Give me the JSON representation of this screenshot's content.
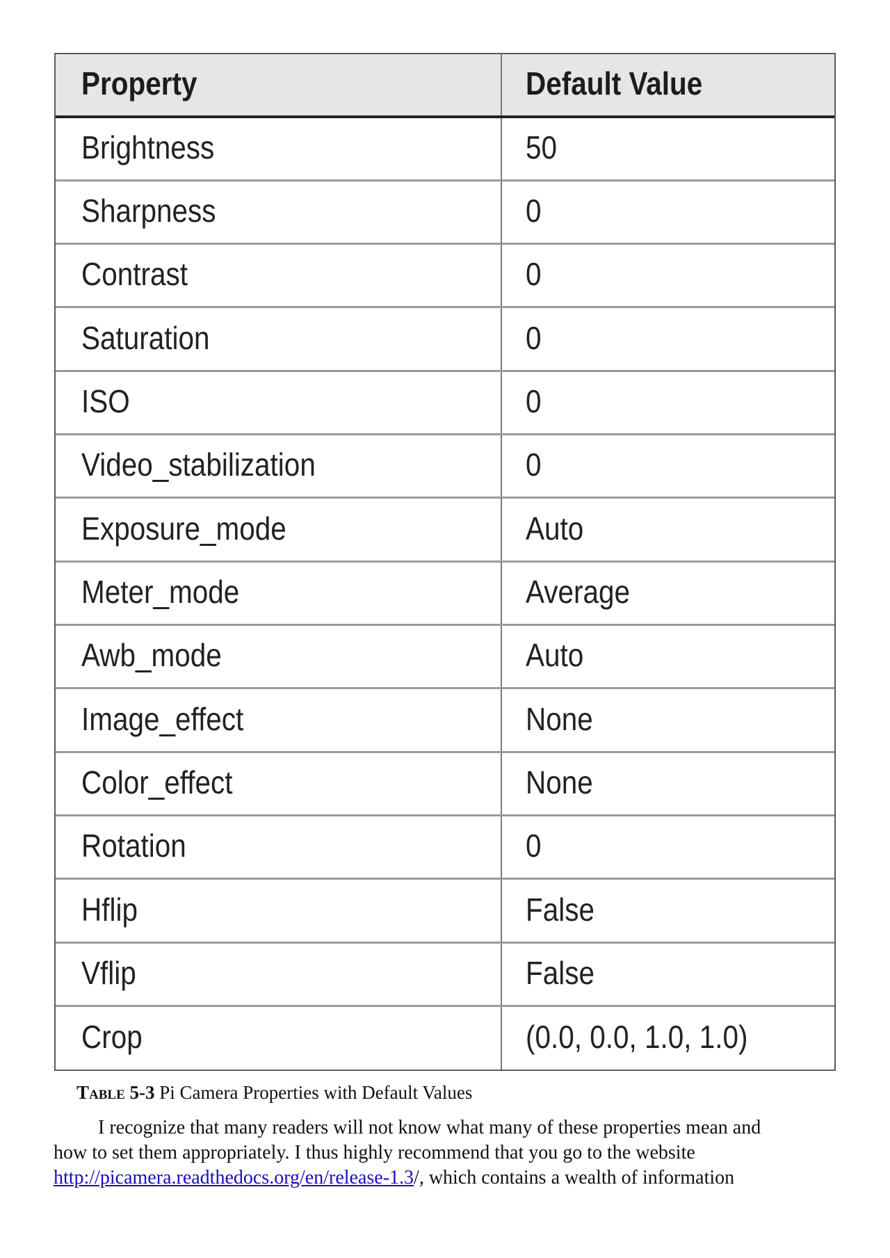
{
  "table": {
    "headers": {
      "property": "Property",
      "default_value": "Default Value"
    },
    "rows": [
      {
        "property": "Brightness",
        "default_value": "50"
      },
      {
        "property": "Sharpness",
        "default_value": "0"
      },
      {
        "property": "Contrast",
        "default_value": "0"
      },
      {
        "property": "Saturation",
        "default_value": "0"
      },
      {
        "property": "ISO",
        "default_value": "0"
      },
      {
        "property": "Video_stabilization",
        "default_value": "0"
      },
      {
        "property": "Exposure_mode",
        "default_value": "Auto"
      },
      {
        "property": "Meter_mode",
        "default_value": "Average"
      },
      {
        "property": "Awb_mode",
        "default_value": "Auto"
      },
      {
        "property": "Image_effect",
        "default_value": "None"
      },
      {
        "property": "Color_effect",
        "default_value": "None"
      },
      {
        "property": "Rotation",
        "default_value": "0"
      },
      {
        "property": "Hflip",
        "default_value": "False"
      },
      {
        "property": "Vflip",
        "default_value": "False"
      },
      {
        "property": "Crop",
        "default_value": "(0.0, 0.0, 1.0, 1.0)"
      }
    ]
  },
  "caption": {
    "label": "Table 5-3",
    "text": " Pi Camera Properties with Default Values"
  },
  "paragraph": {
    "line1": "I recognize that many readers will not know what many of these properties mean and",
    "line2": "how to set them appropriately. I thus highly recommend that you go to the website",
    "link_text": "http://picamera.readthedocs.org/en/release-1.3",
    "line3_rest": "/, which contains a wealth of information"
  },
  "colors": {
    "header_bg": "#e6e6e8",
    "link": "#1a0dbb",
    "text": "#222222"
  }
}
